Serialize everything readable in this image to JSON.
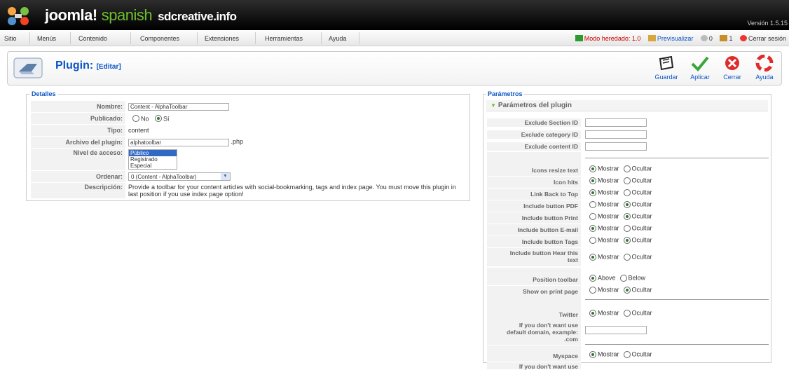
{
  "header": {
    "brand": "joomla!",
    "brand_suffix": "spanish",
    "site": "sdcreative.info",
    "version": "Versión 1.5.15"
  },
  "menu": [
    "Sitio",
    "Menús",
    "Contenido",
    "Componentes",
    "Extensiones",
    "Herramientas",
    "Ayuda"
  ],
  "status": {
    "legacy": "Modo heredado: 1.0",
    "preview": "Previsualizar",
    "messages": "0",
    "users": "1",
    "logout": "Cerrar sesión"
  },
  "page": {
    "title": "Plugin:",
    "subtitle": "[Editar]"
  },
  "toolbar": {
    "save": "Guardar",
    "apply": "Aplicar",
    "close": "Cerrar",
    "help": "Ayuda"
  },
  "details": {
    "legend": "Detalles",
    "name_label": "Nombre:",
    "name_value": "Content - AlphaToolbar",
    "published_label": "Publicado:",
    "no": "No",
    "yes": "Sí",
    "type_label": "Tipo:",
    "type_value": "content",
    "file_label": "Archivo del plugin:",
    "file_value": "alphatoolbar",
    "file_ext": ".php",
    "access_label": "Nivel de acceso:",
    "access_options": [
      "Público",
      "Registrado",
      "Especial"
    ],
    "order_label": "Ordenar:",
    "order_value": "0 (Content - AlphaToolbar)",
    "desc_label": "Descripción:",
    "desc_value": "Provide a toolbar for your content articles with social-bookmarking, tags and index page. You must move this plugin in last position if you use index page option!"
  },
  "params": {
    "legend": "Parámetros",
    "header": "Parámetros del plugin",
    "show": "Mostrar",
    "hide": "Ocultar",
    "above": "Above",
    "below": "Below",
    "exclude_section": "Exclude Section ID",
    "exclude_category": "Exclude category ID",
    "exclude_content": "Exclude content ID",
    "icons_resize": "Icons resize text",
    "icon_hits": "Icon hits",
    "link_back": "Link Back to Top",
    "btn_pdf": "Include button PDF",
    "btn_print": "Include button Print",
    "btn_email": "Include button E-mail",
    "btn_tags": "Include button Tags",
    "btn_hear_1": "Include button Hear this",
    "btn_hear_2": "text",
    "position_toolbar": "Position toolbar",
    "show_print": "Show on print page",
    "twitter": "Twitter",
    "domain_1": "If you don't want use",
    "domain_2": "default domain, example:",
    "domain_3": ".com",
    "myspace": "Myspace",
    "myspace_next": "If you don't want use"
  }
}
